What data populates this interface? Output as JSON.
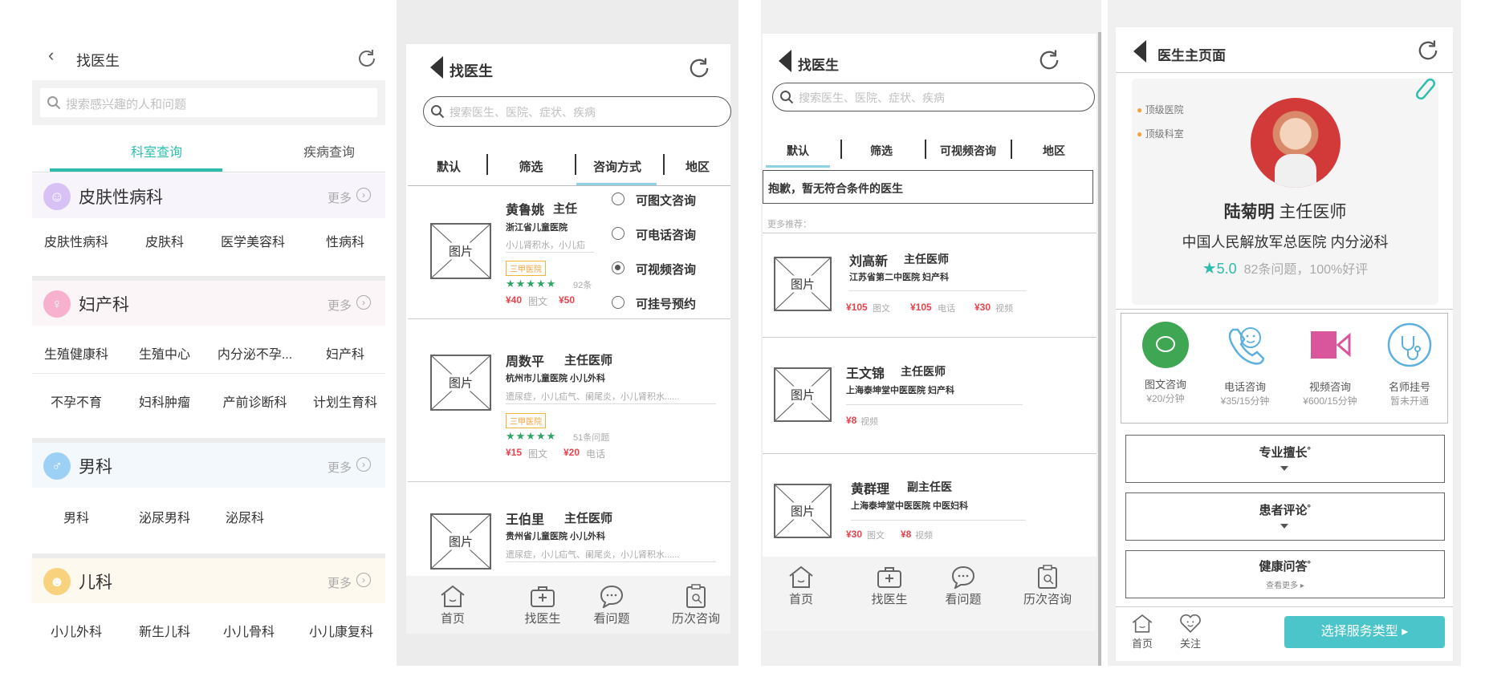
{
  "p1": {
    "title": "找医生",
    "search_placeholder": "搜索感兴趣的人和问题",
    "tabs": [
      "科室查询",
      "疾病查询"
    ],
    "more": "更多",
    "sections": [
      {
        "name": "皮肤性病科",
        "icon_color": "#c9a7f2",
        "items": [
          "皮肤性病科",
          "皮肤科",
          "医学美容科",
          "性病科"
        ]
      },
      {
        "name": "妇产科",
        "icon_color": "#f59bbf",
        "items": [
          "生殖健康科",
          "生殖中心",
          "内分泌不孕...",
          "妇产科",
          "不孕不育",
          "妇科肿瘤",
          "产前诊断科",
          "计划生育科"
        ]
      },
      {
        "name": "男科",
        "icon_color": "#7ec0f0",
        "items": [
          "男科",
          "泌尿男科",
          "泌尿科"
        ]
      },
      {
        "name": "儿科",
        "icon_color": "#f7c55a",
        "items": [
          "小儿外科",
          "新生儿科",
          "小儿骨科",
          "小儿康复科"
        ]
      }
    ]
  },
  "p2": {
    "title": "找医生",
    "search_placeholder": "搜索医生、医院、症状、疾病",
    "filters": [
      "默认",
      "筛选",
      "咨询方式",
      "地区"
    ],
    "img_label": "图片",
    "options": [
      "可图文咨询",
      "可电话咨询",
      "可视频咨询",
      "可挂号预约"
    ],
    "selected_option": "可视频咨询",
    "doctors": [
      {
        "name": "黄鲁姚",
        "title": "主任",
        "hospital": "浙江省儿童医院",
        "skills": "小儿肾积水，小儿疝",
        "badge": "三甲医院",
        "stars": "★★★★★",
        "count": "92条",
        "price1": "¥40",
        "type1": "图文",
        "price2": "¥50",
        "type2": ""
      },
      {
        "name": "周数平",
        "title": "主任医师",
        "hospital": "杭州市儿童医院 小儿外科",
        "skills": "遗尿症，小儿疝气、阑尾炎，小儿肾积水......",
        "badge": "三甲医院",
        "stars": "★★★★★",
        "count": "51条问题",
        "price1": "¥15",
        "type1": "图文",
        "price2": "¥20",
        "type2": "电话"
      },
      {
        "name": "王伯里",
        "title": "主任医师",
        "hospital": "贵州省儿童医院 小儿外科",
        "skills": "遗尿症，小儿疝气、阑尾炎，小儿肾积水......"
      }
    ],
    "nav": [
      "首页",
      "找医生",
      "看问题",
      "历次咨询"
    ]
  },
  "p3": {
    "title": "找医生",
    "search_placeholder": "搜索医生、医院、症状、疾病",
    "filters": [
      "默认",
      "筛选",
      "可视频咨询",
      "地区"
    ],
    "notice": "抱歉，暂无符合条件的医生",
    "more_rec": "更多推荐：",
    "img_label": "图片",
    "doctors": [
      {
        "name": "刘高新",
        "title": "主任医师",
        "hospital": "江苏省第二中医院 妇产科",
        "p1": "¥105",
        "t1": "图文",
        "p2": "¥105",
        "t2": "电话",
        "p3": "¥30",
        "t3": "视频"
      },
      {
        "name": "王文锦",
        "title": "主任医师",
        "hospital": "上海泰坤堂中医医院 妇产科",
        "p1": "¥8",
        "t1": "视频"
      },
      {
        "name": "黄群理",
        "title": "副主任医",
        "hospital": "上海泰坤堂中医医院 中医妇科",
        "p1": "¥30",
        "t1": "图文",
        "p2": "¥8",
        "t2": "视频"
      }
    ],
    "nav": [
      "首页",
      "找医生",
      "看问题",
      "历次咨询"
    ]
  },
  "p4": {
    "title": "医生主页面",
    "tags": [
      "顶级医院",
      "顶级科室"
    ],
    "doctor_name": "陆菊明",
    "doctor_title": "主任医师",
    "hospital": "中国人民解放军总医院 内分泌科",
    "rating": "5.0",
    "stats": "82条问题，100%好评",
    "services": [
      {
        "label": "图文咨询",
        "price": "¥20/分钟"
      },
      {
        "label": "电话咨询",
        "price": "¥35/15分钟"
      },
      {
        "label": "视频咨询",
        "price": "¥600/15分钟"
      },
      {
        "label": "名师挂号",
        "price": "暂未开通"
      }
    ],
    "sections": [
      "专业擅长˚",
      "患者评论˚",
      "健康问答˚"
    ],
    "see_more": "查看更多 ▸",
    "nav": [
      "首页",
      "关注"
    ],
    "cta": "选择服务类型 ▸"
  }
}
